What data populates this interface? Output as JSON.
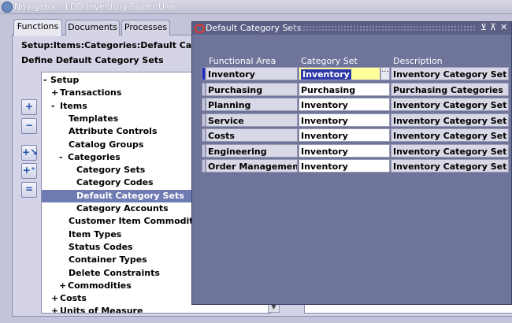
{
  "navigator": {
    "title": "Navigator - LDD Inventory Super User",
    "tabs": [
      {
        "label": "Functions",
        "active": true
      },
      {
        "label": "Documents",
        "active": false
      },
      {
        "label": "Processes",
        "active": false
      }
    ],
    "path": "Setup:Items:Categories:Default Category S",
    "page_title": "Define Default Category Sets",
    "tree": [
      {
        "prefix": "-",
        "label": "Setup",
        "indent": 0
      },
      {
        "prefix": "+",
        "label": "Transactions",
        "indent": 1
      },
      {
        "prefix": "-",
        "label": "Items",
        "indent": 1
      },
      {
        "prefix": "",
        "label": "Templates",
        "indent": 2
      },
      {
        "prefix": "",
        "label": "Attribute Controls",
        "indent": 2
      },
      {
        "prefix": "",
        "label": "Catalog Groups",
        "indent": 2
      },
      {
        "prefix": "-",
        "label": "Categories",
        "indent": 2
      },
      {
        "prefix": "",
        "label": "Category Sets",
        "indent": 3
      },
      {
        "prefix": "",
        "label": "Category Codes",
        "indent": 3
      },
      {
        "prefix": "",
        "label": "Default Category Sets",
        "indent": 3,
        "selected": true
      },
      {
        "prefix": "",
        "label": "Category Accounts",
        "indent": 3
      },
      {
        "prefix": "",
        "label": "Customer Item Commodity Co",
        "indent": 2
      },
      {
        "prefix": "",
        "label": "Item Types",
        "indent": 2
      },
      {
        "prefix": "",
        "label": "Status Codes",
        "indent": 2
      },
      {
        "prefix": "",
        "label": "Container Types",
        "indent": 2
      },
      {
        "prefix": "",
        "label": "Delete Constraints",
        "indent": 2
      },
      {
        "prefix": "+",
        "label": "Commodities",
        "indent": 2
      },
      {
        "prefix": "+",
        "label": "Costs",
        "indent": 1
      },
      {
        "prefix": "+",
        "label": "Units of Measure",
        "indent": 1
      }
    ],
    "side_buttons": [
      {
        "name": "expand-icon",
        "glyph": "+"
      },
      {
        "name": "collapse-icon",
        "glyph": "−"
      },
      {
        "name": "expand-branch-icon",
        "glyph": "+↘"
      },
      {
        "name": "expand-all-icon",
        "glyph": "+⁺"
      },
      {
        "name": "collapse-all-icon",
        "glyph": "="
      }
    ]
  },
  "dialog": {
    "title": "Default Category Sets",
    "controls": [
      "⊻",
      "⊼",
      "✕"
    ],
    "columns": {
      "functional_area": "Functional Area",
      "category_set": "Category Set",
      "description": "Description"
    },
    "rows": [
      {
        "functional_area": "Inventory",
        "category_set": "Inventory",
        "description": "Inventory Category Set",
        "current": true
      },
      {
        "functional_area": "Purchasing",
        "category_set": "Purchasing",
        "description": "Purchasing Categories"
      },
      {
        "functional_area": "Planning",
        "category_set": "Inventory",
        "description": "Inventory Category Set"
      },
      {
        "functional_area": "Service",
        "category_set": "Inventory",
        "description": "Inventory Category Set"
      },
      {
        "functional_area": "Costs",
        "category_set": "Inventory",
        "description": "Inventory Category Set"
      },
      {
        "functional_area": "Engineering",
        "category_set": "Inventory",
        "description": "Inventory Category Set"
      },
      {
        "functional_area": "Order Management",
        "category_set": "Inventory",
        "description": "Inventory Category Set"
      }
    ],
    "lov_glyph": "···"
  }
}
